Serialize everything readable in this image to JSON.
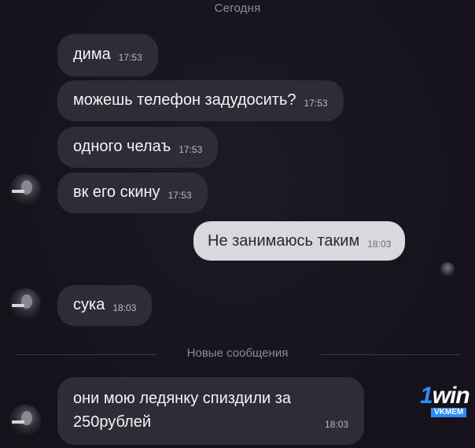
{
  "chat": {
    "date_separator": "Сегодня",
    "new_messages_separator": "Новые сообщения",
    "messages": [
      {
        "direction": "in",
        "text": "дима",
        "time": "17:53"
      },
      {
        "direction": "in",
        "text": "можешь телефон задудосить?",
        "time": "17:53"
      },
      {
        "direction": "in",
        "text": "одного челаъ",
        "time": "17:53"
      },
      {
        "direction": "in",
        "text": "вк его скину",
        "time": "17:53"
      },
      {
        "direction": "out",
        "text": "Не занимаюсь таким",
        "time": "18:03"
      },
      {
        "direction": "in",
        "text": "сука",
        "time": "18:03"
      },
      {
        "direction": "in",
        "text": "они мою ледянку спиздили за 250рублей",
        "time": "18:03"
      }
    ]
  },
  "watermark": {
    "brand": "1win",
    "sub": "VKMEM"
  },
  "colors": {
    "background": "#17141e",
    "incoming_bubble": "#2f2c37",
    "outgoing_bubble": "#d9d8de",
    "watermark_accent": "#2e8cff"
  }
}
